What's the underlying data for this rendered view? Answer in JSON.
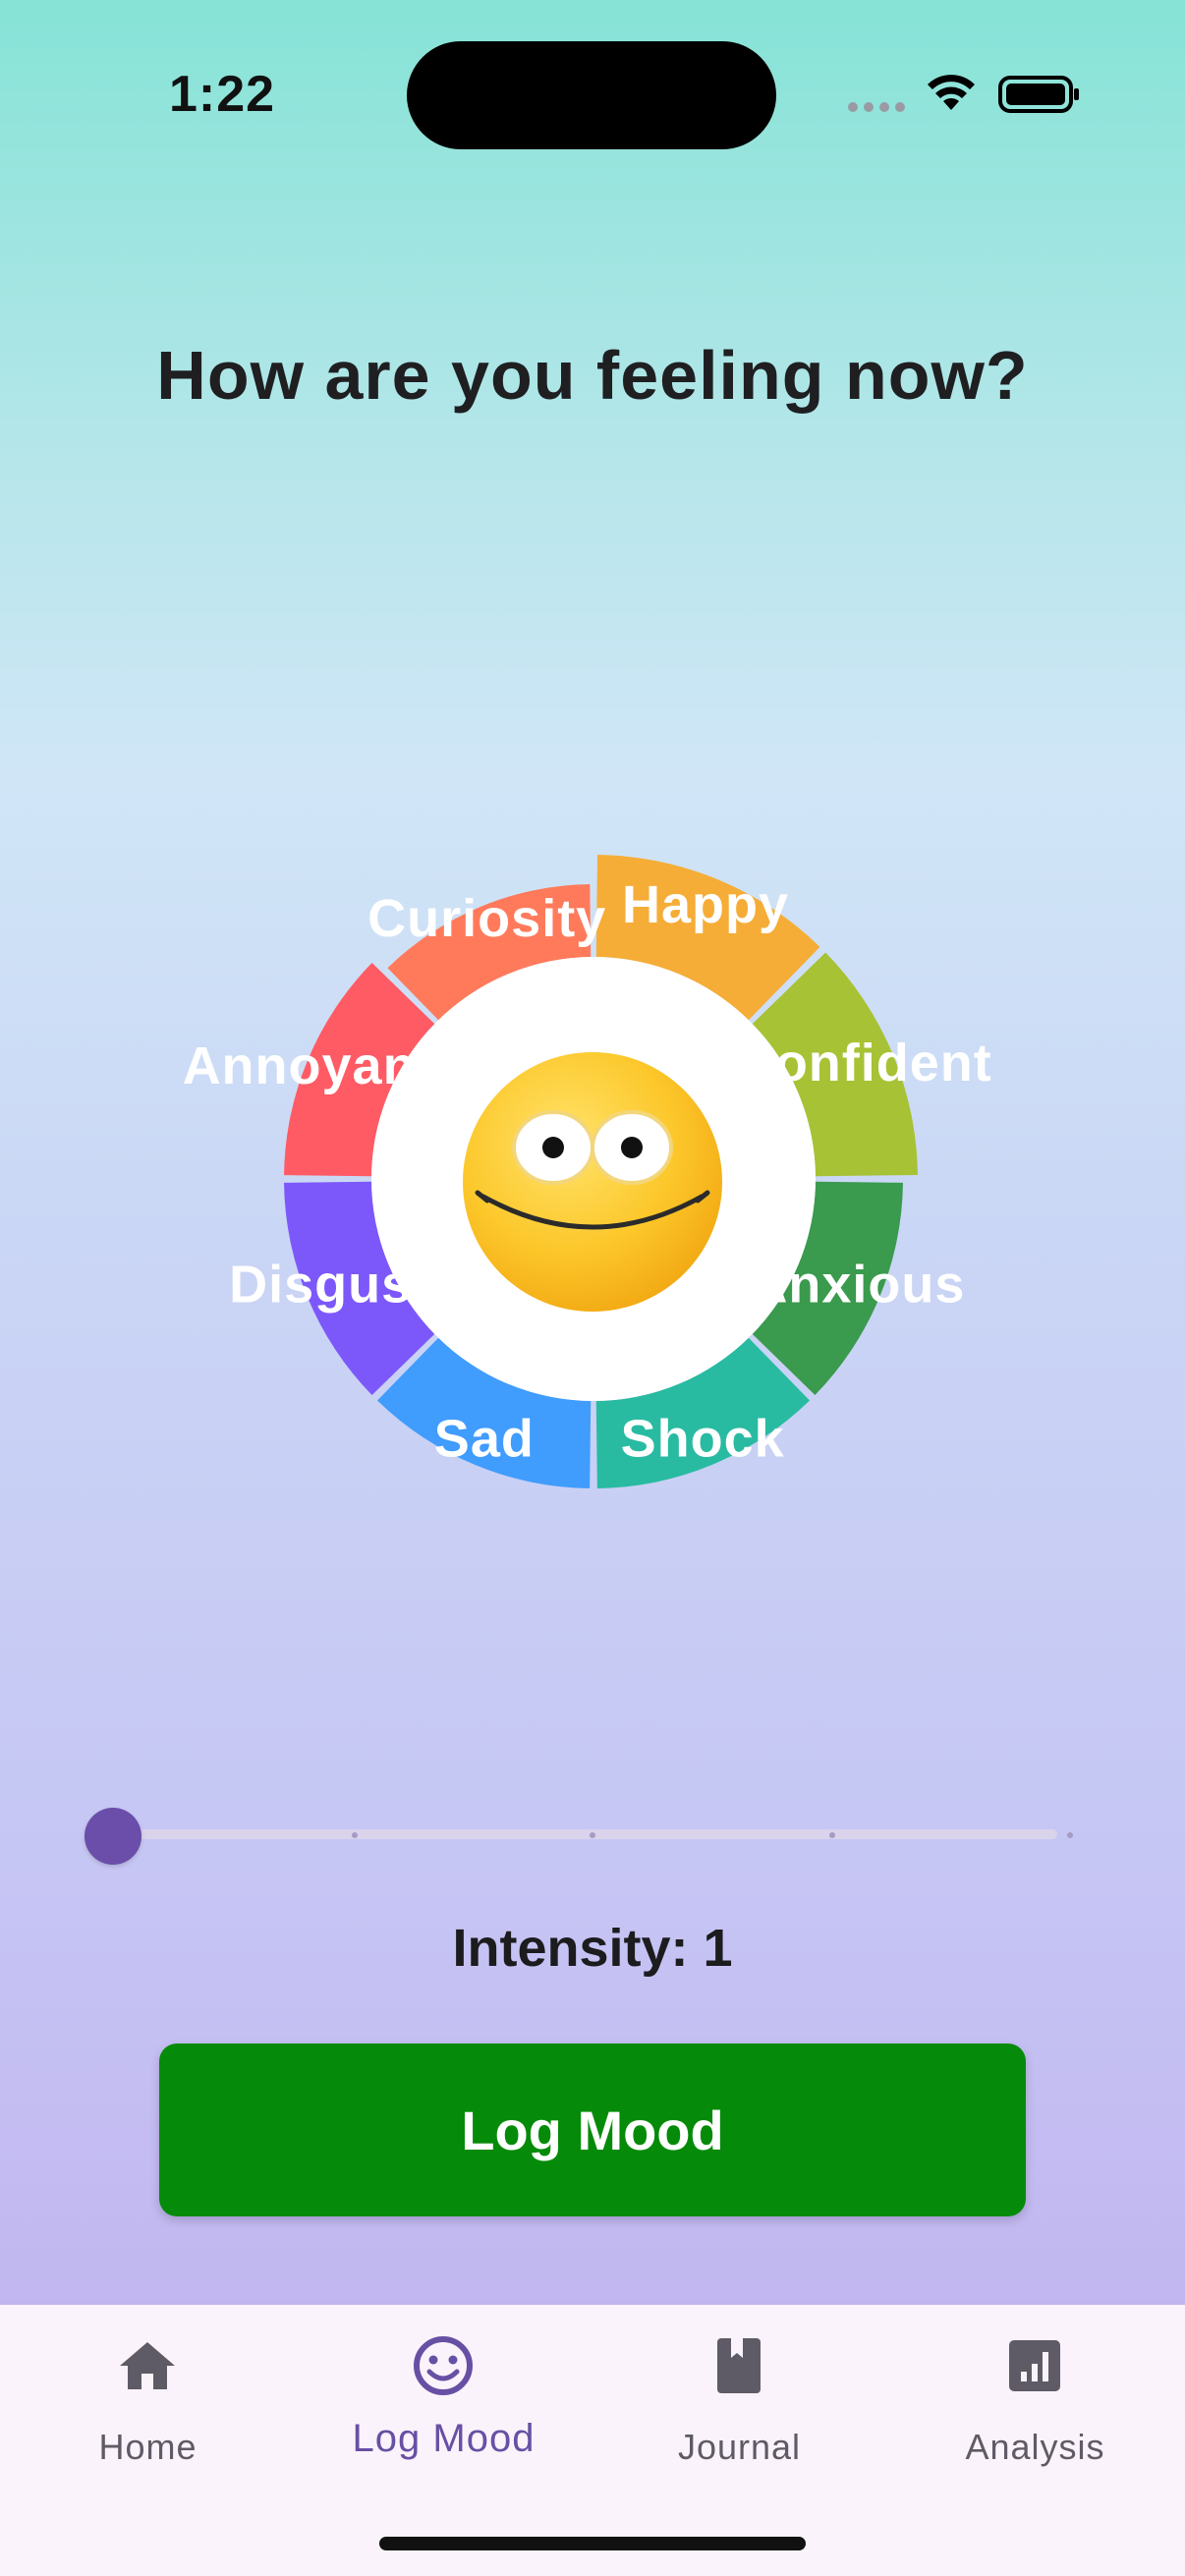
{
  "status_bar": {
    "time": "1:22",
    "icons": [
      "signal-icon",
      "wifi-icon",
      "battery-icon"
    ]
  },
  "page": {
    "title": "How are you feeling now?"
  },
  "wheel": {
    "center_icon": "smiling-face-emoji-icon",
    "segments": [
      {
        "label": "Happy",
        "color": "#f5ad37"
      },
      {
        "label": "Confident",
        "color": "#a7c234"
      },
      {
        "label": "Anxious",
        "color": "#3a9a4d"
      },
      {
        "label": "Shock",
        "color": "#28bba1"
      },
      {
        "label": "Sad",
        "color": "#409cfd"
      },
      {
        "label": "Disgust",
        "color": "#7c58fb"
      },
      {
        "label": "Annoyance",
        "color": "#ff5b65"
      },
      {
        "label": "Curiosity",
        "color": "#ff7a5b"
      }
    ]
  },
  "intensity": {
    "label": "Intensity: 1",
    "value": 1,
    "min": 1,
    "max": 5,
    "accent": "#6a4ea9"
  },
  "actions": {
    "log_button": "Log Mood",
    "log_button_color": "#058b09"
  },
  "bottom_nav": {
    "items": [
      {
        "label": "Home",
        "icon": "home-icon",
        "active": false
      },
      {
        "label": "Log Mood",
        "icon": "smiley-icon",
        "active": true
      },
      {
        "label": "Journal",
        "icon": "book-icon",
        "active": false
      },
      {
        "label": "Analysis",
        "icon": "analytics-icon",
        "active": false
      }
    ],
    "active_color": "#6750a4"
  }
}
